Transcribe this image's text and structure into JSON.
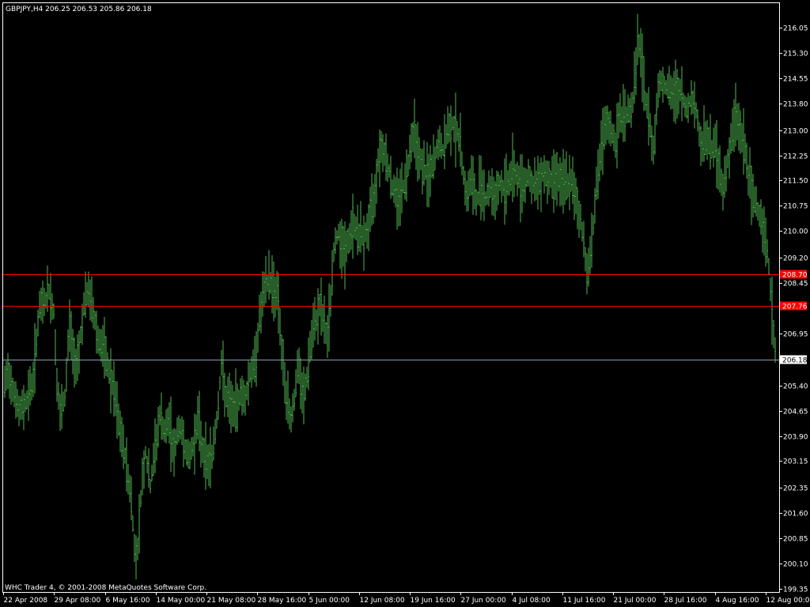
{
  "window": {
    "header": "GBPJPY,H4  206.25 206.53 205.86 206.18",
    "copyright": "WHC Trader 4, © 2001-2008 MetaQuotes Software Corp."
  },
  "colors": {
    "background": "#000000",
    "frame": "#ffffff",
    "bars": "#4fb84f",
    "level_lines": "#ff0000",
    "bid_line": "#8f9fb0",
    "price_label_bg": "#ffffff"
  },
  "chart_data": {
    "type": "bar",
    "symbol": "GBPJPY",
    "timeframe": "H4",
    "ohlc_last": {
      "open": 206.25,
      "high": 206.53,
      "low": 205.86,
      "close": 206.18
    },
    "ylim": [
      199.35,
      216.65
    ],
    "y_ticks": [
      "216.05",
      "215.30",
      "214.55",
      "213.80",
      "213.00",
      "212.25",
      "211.50",
      "210.75",
      "210.00",
      "209.20",
      "208.45",
      "206.95",
      "205.40",
      "204.65",
      "203.90",
      "203.15",
      "202.35",
      "201.60",
      "200.85",
      "200.10",
      "199.35"
    ],
    "x_ticks": [
      "22 Apr 2008",
      "29 Apr 08:00",
      "6 May 16:00",
      "14 May 00:00",
      "21 May 08:00",
      "28 May 16:00",
      "5 Jun 00:00",
      "12 Jun 08:00",
      "19 Jun 16:00",
      "27 Jun 00:00",
      "4 Jul 08:00",
      "11 Jul 16:00",
      "21 Jul 00:00",
      "28 Jul 16:00",
      "4 Aug 16:00",
      "12 Aug 00:00"
    ],
    "horizontal_lines": [
      {
        "price": 208.7,
        "label": "208.70"
      },
      {
        "price": 207.76,
        "label": "207.76"
      }
    ],
    "bid": {
      "price": 206.18,
      "label": "206.18"
    },
    "path": [
      [
        0,
        205.2
      ],
      [
        6,
        205.8
      ],
      [
        12,
        205.4
      ],
      [
        20,
        204.6
      ],
      [
        30,
        205.0
      ],
      [
        38,
        205.6
      ],
      [
        45,
        207.6
      ],
      [
        52,
        207.9
      ],
      [
        58,
        208.2
      ],
      [
        64,
        207.6
      ],
      [
        68,
        205.5
      ],
      [
        72,
        204.5
      ],
      [
        78,
        205.0
      ],
      [
        84,
        207.3
      ],
      [
        90,
        206.0
      ],
      [
        96,
        206.5
      ],
      [
        102,
        207.8
      ],
      [
        108,
        208.2
      ],
      [
        114,
        207.6
      ],
      [
        120,
        206.8
      ],
      [
        126,
        206.5
      ],
      [
        132,
        206.0
      ],
      [
        140,
        205.2
      ],
      [
        148,
        204.0
      ],
      [
        155,
        203.2
      ],
      [
        162,
        202.0
      ],
      [
        167,
        200.2
      ],
      [
        171,
        200.8
      ],
      [
        175,
        202.5
      ],
      [
        180,
        203.4
      ],
      [
        186,
        202.4
      ],
      [
        192,
        203.5
      ],
      [
        198,
        204.5
      ],
      [
        204,
        204.0
      ],
      [
        210,
        204.3
      ],
      [
        216,
        203.4
      ],
      [
        222,
        204.2
      ],
      [
        228,
        203.8
      ],
      [
        234,
        203.2
      ],
      [
        240,
        203.6
      ],
      [
        246,
        204.4
      ],
      [
        252,
        203.5
      ],
      [
        258,
        203.1
      ],
      [
        264,
        203.3
      ],
      [
        270,
        204.4
      ],
      [
        276,
        206.0
      ],
      [
        282,
        205.0
      ],
      [
        288,
        204.8
      ],
      [
        294,
        204.7
      ],
      [
        300,
        205.2
      ],
      [
        306,
        205.0
      ],
      [
        312,
        205.8
      ],
      [
        318,
        206.0
      ],
      [
        324,
        207.4
      ],
      [
        330,
        208.2
      ],
      [
        336,
        208.6
      ],
      [
        342,
        208.3
      ],
      [
        348,
        208.0
      ],
      [
        353,
        206.0
      ],
      [
        358,
        205.1
      ],
      [
        363,
        204.4
      ],
      [
        368,
        205.0
      ],
      [
        373,
        206.1
      ],
      [
        378,
        205.0
      ],
      [
        383,
        205.4
      ],
      [
        388,
        206.5
      ],
      [
        394,
        207.2
      ],
      [
        400,
        207.8
      ],
      [
        406,
        207.2
      ],
      [
        410,
        206.8
      ],
      [
        414,
        208.0
      ],
      [
        418,
        209.4
      ],
      [
        424,
        210.0
      ],
      [
        430,
        209.4
      ],
      [
        436,
        209.6
      ],
      [
        442,
        210.2
      ],
      [
        448,
        210.0
      ],
      [
        454,
        209.8
      ],
      [
        460,
        210.0
      ],
      [
        465,
        210.6
      ],
      [
        470,
        211.2
      ],
      [
        475,
        212.4
      ],
      [
        480,
        212.5
      ],
      [
        486,
        212.0
      ],
      [
        492,
        211.3
      ],
      [
        498,
        211.0
      ],
      [
        504,
        211.2
      ],
      [
        510,
        211.6
      ],
      [
        515,
        212.7
      ],
      [
        520,
        213.0
      ],
      [
        526,
        212.2
      ],
      [
        532,
        211.8
      ],
      [
        538,
        211.6
      ],
      [
        544,
        212.0
      ],
      [
        550,
        212.6
      ],
      [
        556,
        212.4
      ],
      [
        562,
        213.0
      ],
      [
        568,
        213.2
      ],
      [
        574,
        213.0
      ],
      [
        580,
        212.1
      ],
      [
        586,
        211.0
      ],
      [
        592,
        211.6
      ],
      [
        598,
        210.8
      ],
      [
        604,
        211.5
      ],
      [
        610,
        211.0
      ],
      [
        616,
        211.3
      ],
      [
        622,
        211.0
      ],
      [
        628,
        211.4
      ],
      [
        634,
        211.2
      ],
      [
        640,
        211.6
      ],
      [
        646,
        211.8
      ],
      [
        652,
        211.5
      ],
      [
        658,
        211.4
      ],
      [
        664,
        211.7
      ],
      [
        670,
        211.3
      ],
      [
        676,
        211.4
      ],
      [
        682,
        211.8
      ],
      [
        688,
        211.6
      ],
      [
        694,
        211.5
      ],
      [
        700,
        211.8
      ],
      [
        706,
        211.3
      ],
      [
        712,
        211.5
      ],
      [
        718,
        211.4
      ],
      [
        724,
        211.0
      ],
      [
        730,
        210.3
      ],
      [
        735,
        209.5
      ],
      [
        739,
        208.6
      ],
      [
        743,
        209.5
      ],
      [
        748,
        210.8
      ],
      [
        753,
        212.0
      ],
      [
        758,
        212.6
      ],
      [
        763,
        213.2
      ],
      [
        768,
        213.0
      ],
      [
        774,
        212.6
      ],
      [
        780,
        213.4
      ],
      [
        786,
        213.5
      ],
      [
        792,
        213.5
      ],
      [
        797,
        214.0
      ],
      [
        802,
        215.6
      ],
      [
        806,
        215.3
      ],
      [
        810,
        214.2
      ],
      [
        816,
        213.4
      ],
      [
        822,
        212.4
      ],
      [
        828,
        214.3
      ],
      [
        834,
        214.5
      ],
      [
        840,
        214.2
      ],
      [
        846,
        214.0
      ],
      [
        852,
        214.2
      ],
      [
        858,
        214.0
      ],
      [
        864,
        213.6
      ],
      [
        870,
        214.0
      ],
      [
        876,
        213.6
      ],
      [
        880,
        212.8
      ],
      [
        885,
        212.6
      ],
      [
        890,
        212.8
      ],
      [
        895,
        212.4
      ],
      [
        900,
        212.6
      ],
      [
        905,
        211.8
      ],
      [
        910,
        211.3
      ],
      [
        915,
        212.0
      ],
      [
        920,
        212.6
      ],
      [
        926,
        213.5
      ],
      [
        932,
        213.0
      ],
      [
        937,
        212.5
      ],
      [
        942,
        211.7
      ],
      [
        947,
        211.0
      ],
      [
        952,
        210.8
      ],
      [
        957,
        210.5
      ],
      [
        962,
        210.0
      ],
      [
        966,
        209.4
      ],
      [
        969,
        208.6
      ],
      [
        972,
        207.6
      ],
      [
        975,
        206.6
      ],
      [
        978,
        206.2
      ],
      [
        981,
        206.18
      ]
    ]
  }
}
